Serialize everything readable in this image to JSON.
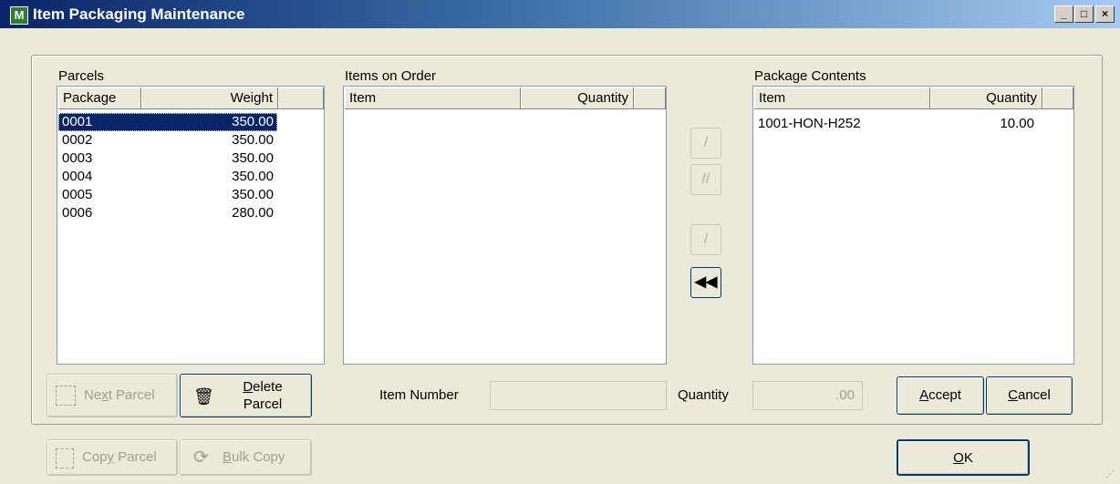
{
  "window": {
    "title": "Item Packaging Maintenance",
    "icon": "M",
    "controls": {
      "minimize": "_",
      "maximize": "□",
      "close": "×"
    }
  },
  "parcels": {
    "label": "Parcels",
    "columns": [
      "Package",
      "Weight"
    ],
    "rows": [
      {
        "package": "0001",
        "weight": "350.00",
        "selected": true
      },
      {
        "package": "0002",
        "weight": "350.00"
      },
      {
        "package": "0003",
        "weight": "350.00"
      },
      {
        "package": "0004",
        "weight": "350.00"
      },
      {
        "package": "0005",
        "weight": "350.00"
      },
      {
        "package": "0006",
        "weight": "280.00"
      }
    ]
  },
  "items_on_order": {
    "label": "Items on Order",
    "columns": [
      "Item",
      "Quantity"
    ],
    "rows": []
  },
  "package_contents": {
    "label": "Package Contents",
    "columns": [
      "Item",
      "Quantity"
    ],
    "rows": [
      {
        "item": "1001-HON-H252",
        "quantity": "10.00"
      }
    ]
  },
  "transfer_buttons": [
    {
      "name": "move-one-right-button",
      "glyph": "/",
      "enabled": false
    },
    {
      "name": "move-all-right-button",
      "glyph": "//",
      "enabled": false
    },
    {
      "name": "move-one-left-button",
      "glyph": "/",
      "enabled": false
    },
    {
      "name": "move-all-left-button",
      "glyph": "◀◀",
      "enabled": true
    }
  ],
  "buttons": {
    "next_parcel": {
      "pre": "Ne",
      "key": "x",
      "post": "t Parcel"
    },
    "delete_parcel": {
      "line1_key": "D",
      "line1": "elete",
      "line2": "Parcel"
    },
    "accept": {
      "key": "A",
      "rest": "ccept"
    },
    "cancel": {
      "key": "C",
      "rest": "ancel"
    },
    "copy_parcel": {
      "pre": "Cop",
      "key": "y",
      "post": " Parcel"
    },
    "bulk_copy": {
      "key": "B",
      "post": "ulk Copy"
    },
    "ok": {
      "key": "O",
      "rest": "K"
    }
  },
  "fields": {
    "item_number": {
      "label": "Item Number",
      "value": ""
    },
    "quantity": {
      "label": "Quantity",
      "value": ".00"
    }
  }
}
